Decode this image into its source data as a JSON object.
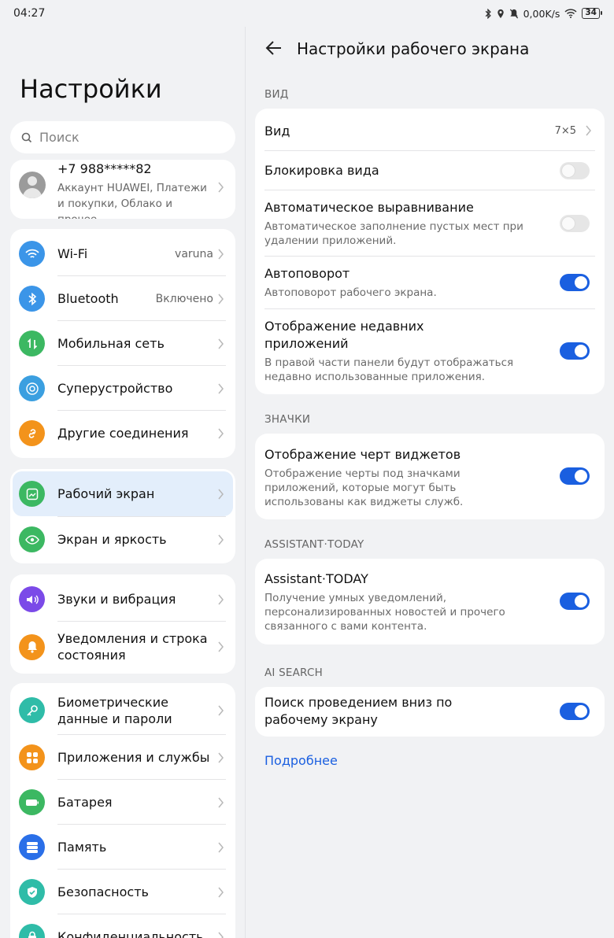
{
  "status": {
    "time": "04:27",
    "speed": "0,00K/s",
    "battery": "34"
  },
  "left": {
    "title": "Настройки",
    "search_placeholder": "Поиск",
    "account": {
      "phone": "+7 988*****82",
      "sub": "Аккаунт HUAWEI, Платежи и покупки, Облако и прочее"
    },
    "groups": [
      {
        "items": [
          {
            "label": "Wi-Fi",
            "value": "varuna",
            "icon": "wifi-icon",
            "color": "#3b95e8"
          },
          {
            "label": "Bluetooth",
            "value": "Включено",
            "icon": "bluetooth-icon",
            "color": "#3b95e8"
          },
          {
            "label": "Мобильная сеть",
            "value": "",
            "icon": "mobile-network-icon",
            "color": "#3cb862"
          },
          {
            "label": "Суперустройство",
            "value": "",
            "icon": "super-device-icon",
            "color": "#3b9fe0"
          },
          {
            "label": "Другие соединения",
            "value": "",
            "icon": "link-icon",
            "color": "#f3931b"
          }
        ]
      },
      {
        "items": [
          {
            "label": "Рабочий экран",
            "value": "",
            "icon": "home-screen-icon",
            "color": "#3cb862"
          },
          {
            "label": "Экран и яркость",
            "value": "",
            "icon": "eye-icon",
            "color": "#3cb862"
          }
        ]
      },
      {
        "items": [
          {
            "label": "Звуки и вибрация",
            "value": "",
            "icon": "sound-icon",
            "color": "#7b4ae8"
          },
          {
            "label": "Уведомления и строка состояния",
            "value": "",
            "icon": "bell-icon",
            "color": "#f3931b"
          }
        ]
      },
      {
        "items": [
          {
            "label": "Биометрические данные и пароли",
            "value": "",
            "icon": "key-icon",
            "color": "#2fbca8"
          },
          {
            "label": "Приложения и службы",
            "value": "",
            "icon": "apps-icon",
            "color": "#f3931b"
          },
          {
            "label": "Батарея",
            "value": "",
            "icon": "battery-icon",
            "color": "#3cb862"
          },
          {
            "label": "Память",
            "value": "",
            "icon": "storage-icon",
            "color": "#2a6fe8"
          },
          {
            "label": "Безопасность",
            "value": "",
            "icon": "shield-icon",
            "color": "#2fbca8"
          },
          {
            "label": "Конфиденциальность",
            "value": "",
            "icon": "privacy-icon",
            "color": "#2fbca8"
          }
        ]
      }
    ]
  },
  "right": {
    "title": "Настройки рабочего экрана",
    "sections": {
      "view": "ВИД",
      "icons": "ЗНАЧКИ",
      "assistant": "ASSISTANT·TODAY",
      "ai": "AI SEARCH"
    },
    "view_item": {
      "title": "Вид",
      "value": "7×5"
    },
    "lock_item": {
      "title": "Блокировка вида",
      "on": false
    },
    "align_item": {
      "title": "Автоматическое выравнивание",
      "desc": "Автоматическое заполнение пустых мест при удалении приложений.",
      "on": false
    },
    "rotate_item": {
      "title": "Автоповорот",
      "desc": "Автоповорот рабочего экрана.",
      "on": true
    },
    "recent_item": {
      "title": "Отображение недавних приложений",
      "desc": "В правой части панели будут отображаться недавно использованные приложения.",
      "on": true
    },
    "widget_item": {
      "title": "Отображение черт виджетов",
      "desc": "Отображение черты под значками приложений, которые могут быть использованы как виджеты служб.",
      "on": true
    },
    "assistant_item": {
      "title": "Assistant·TODAY",
      "desc": "Получение умных уведомлений, персонализированных новостей и прочего связанного с вами контента.",
      "on": true
    },
    "search_item": {
      "title": "Поиск проведением вниз по рабочему экрану",
      "on": true
    },
    "more_link": "Подробнее"
  }
}
